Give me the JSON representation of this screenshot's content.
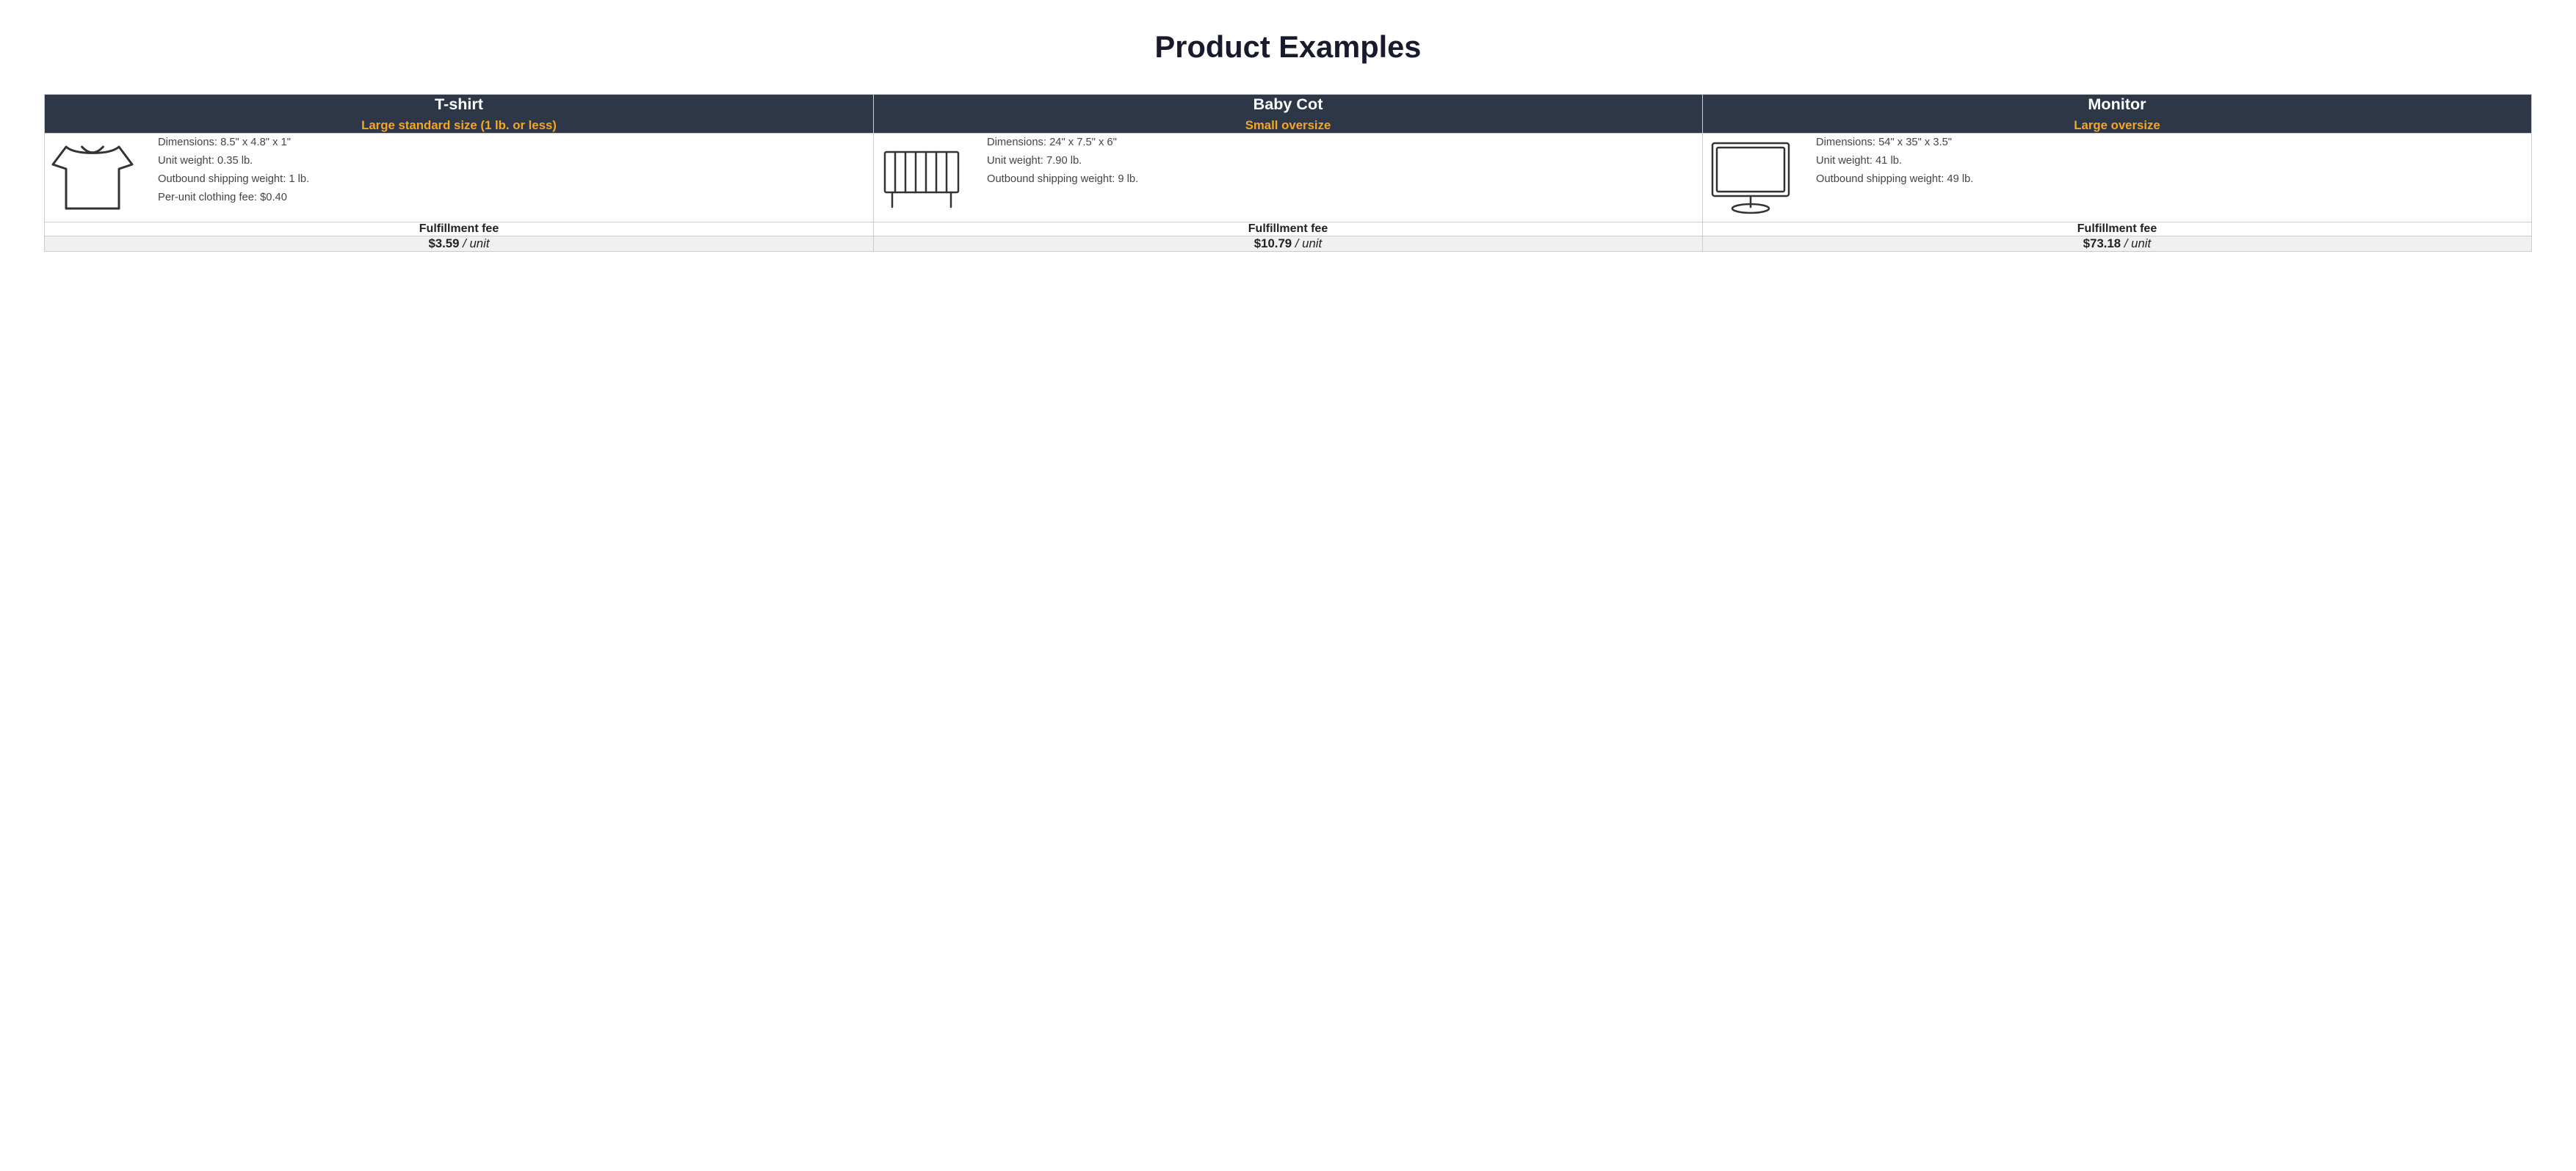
{
  "page": {
    "title": "Product Examples"
  },
  "columns": [
    {
      "id": "tshirt",
      "name": "T-shirt",
      "category": "Large standard size (1 lb. or less)",
      "icon": "tshirt",
      "dimensions": "Dimensions: 8.5\" x 4.8\" x 1\"",
      "weight": "Unit weight: 0.35 lb.",
      "shipping_weight": "Outbound shipping weight: 1 lb.",
      "extra": "Per-unit clothing fee: $0.40",
      "fulfillment_label": "Fulfillment fee",
      "fulfillment_price": "$3.59",
      "fulfillment_unit": "/ unit"
    },
    {
      "id": "babycot",
      "name": "Baby Cot",
      "category": "Small oversize",
      "icon": "cot",
      "dimensions": "Dimensions: 24\" x 7.5\" x 6\"",
      "weight": "Unit weight: 7.90 lb.",
      "shipping_weight": "Outbound shipping weight: 9 lb.",
      "extra": "",
      "fulfillment_label": "Fulfillment fee",
      "fulfillment_price": "$10.79",
      "fulfillment_unit": "/ unit"
    },
    {
      "id": "monitor",
      "name": "Monitor",
      "category": "Large oversize",
      "icon": "monitor",
      "dimensions": "Dimensions: 54\" x 35\" x 3.5\"",
      "weight": "Unit weight: 41 lb.",
      "shipping_weight": "Outbound shipping weight: 49 lb.",
      "extra": "",
      "fulfillment_label": "Fulfillment fee",
      "fulfillment_price": "$73.18",
      "fulfillment_unit": "/ unit"
    }
  ]
}
